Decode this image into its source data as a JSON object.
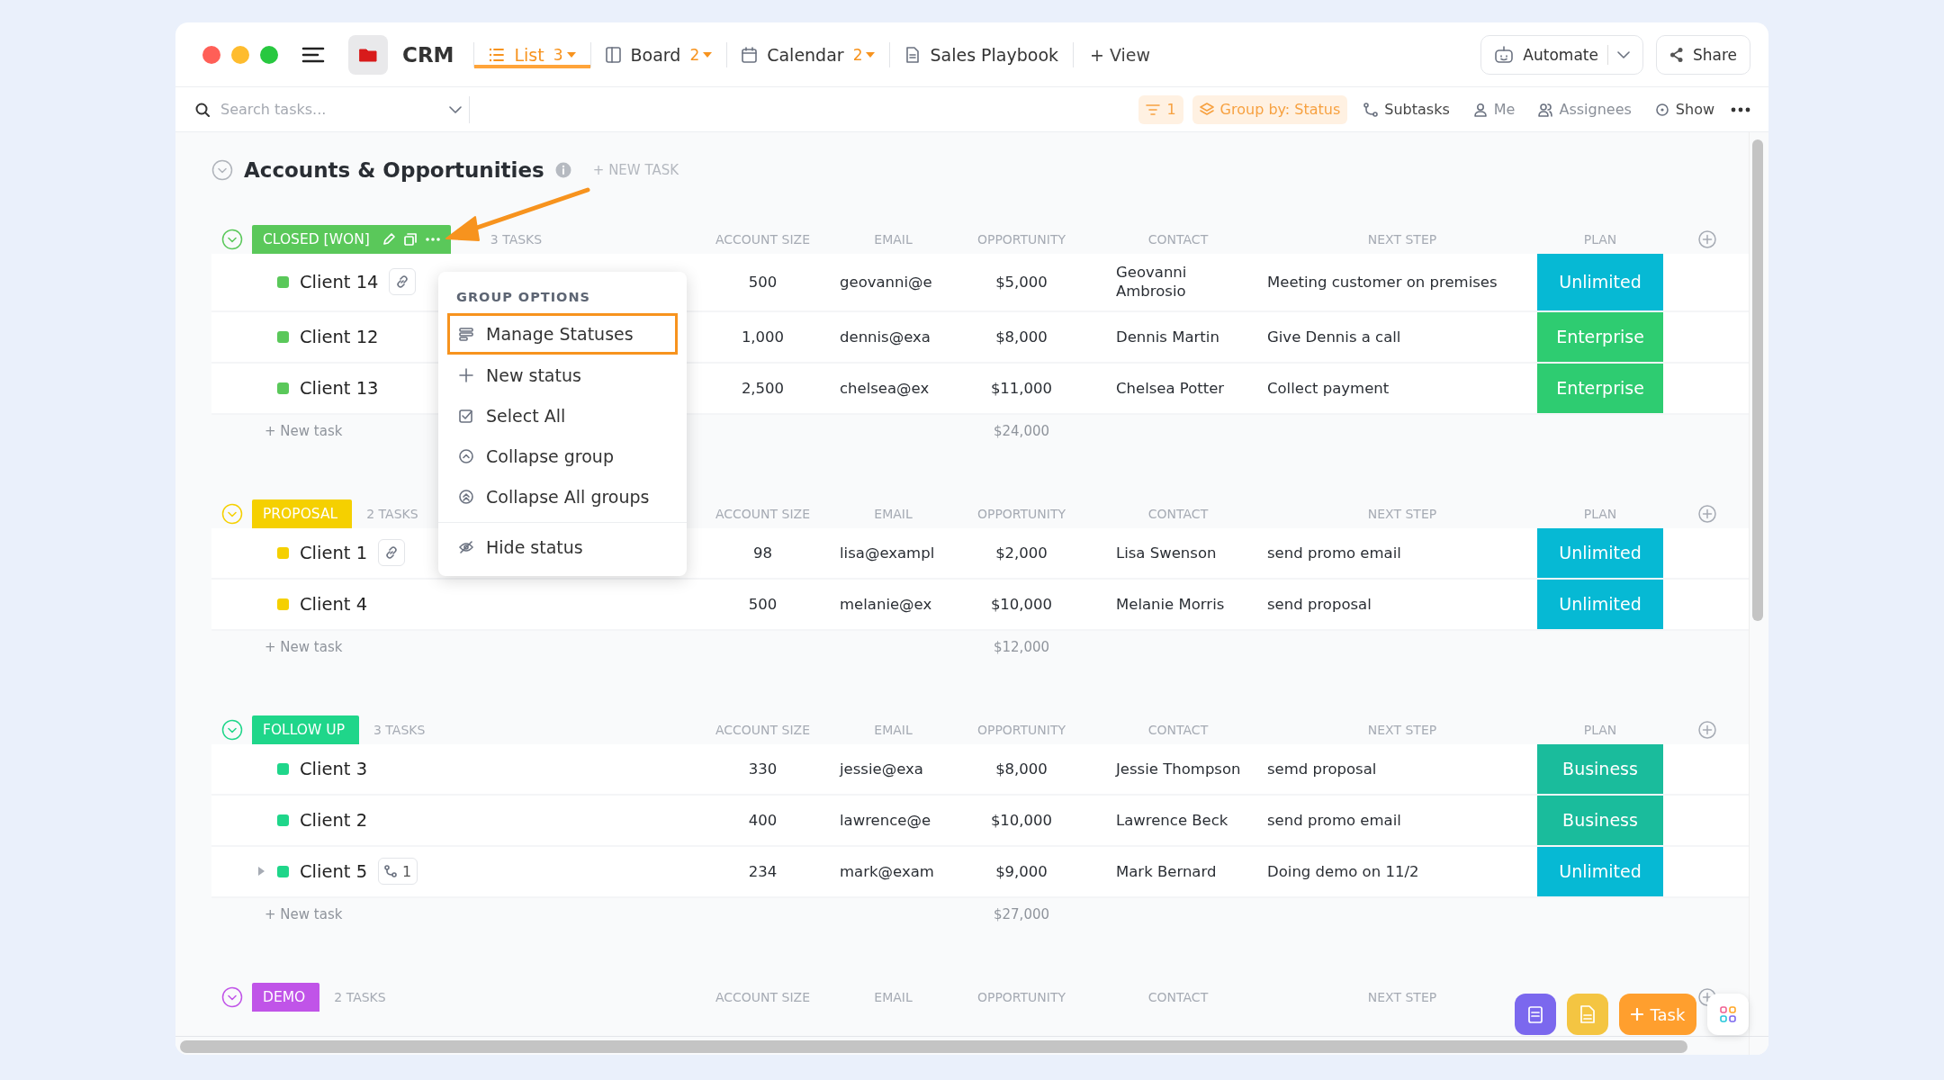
{
  "window": {
    "title": "CRM"
  },
  "tabs": [
    {
      "label": "List",
      "count": "3",
      "selected": true,
      "kind": "list"
    },
    {
      "label": "Board",
      "count": "2",
      "selected": false,
      "kind": "board"
    },
    {
      "label": "Calendar",
      "count": "2",
      "selected": false,
      "kind": "calendar"
    },
    {
      "label": "Sales Playbook",
      "selected": false,
      "kind": "doc"
    }
  ],
  "add_view": "+ View",
  "actions": {
    "automate": "Automate",
    "share": "Share"
  },
  "toolbar": {
    "search_placeholder": "Search tasks...",
    "filter_count": "1",
    "group_by": "Group by: Status",
    "subtasks": "Subtasks",
    "me": "Me",
    "assignees": "Assignees",
    "show": "Show"
  },
  "list": {
    "title": "Accounts & Opportunities",
    "new_task": "+ NEW TASK"
  },
  "groups": [
    {
      "name": "CLOSED [WON]",
      "color": "#5ac85a",
      "hovered": true,
      "task_count": "3 TASKS",
      "columns": [
        "ACCOUNT SIZE",
        "EMAIL",
        "OPPORTUNITY",
        "CONTACT",
        "NEXT STEP",
        "PLAN"
      ],
      "rows": [
        {
          "name": "Client 14",
          "badge": {
            "kind": "link"
          },
          "account_size": "500",
          "email": "geovanni@e",
          "opportunity": "$5,000",
          "contact": "Geovanni Ambrosio",
          "next_step": "Meeting customer on premises",
          "plan": {
            "label": "Unlimited",
            "color": "#06b9d4"
          }
        },
        {
          "name": "Client 12",
          "account_size": "1,000",
          "email": "dennis@exa",
          "opportunity": "$8,000",
          "contact": "Dennis Martin",
          "next_step": "Give Dennis a call",
          "plan": {
            "label": "Enterprise",
            "color": "#2ecc71"
          }
        },
        {
          "name": "Client 13",
          "account_size": "2,500",
          "email": "chelsea@ex",
          "opportunity": "$11,000",
          "contact": "Chelsea Potter",
          "next_step": "Collect payment",
          "plan": {
            "label": "Enterprise",
            "color": "#2ecc71"
          }
        }
      ],
      "new_task": "+ New task",
      "total": "$24,000"
    },
    {
      "name": "PROPOSAL",
      "color": "#f5d000",
      "hovered": false,
      "task_count": "2 TASKS",
      "columns": [
        "ACCOUNT SIZE",
        "EMAIL",
        "OPPORTUNITY",
        "CONTACT",
        "NEXT STEP",
        "PLAN"
      ],
      "rows": [
        {
          "name": "Client 1",
          "badge": {
            "kind": "link"
          },
          "account_size": "98",
          "email": "lisa@exampl",
          "opportunity": "$2,000",
          "contact": "Lisa Swenson",
          "next_step": "send promo email",
          "plan": {
            "label": "Unlimited",
            "color": "#06b9d4"
          }
        },
        {
          "name": "Client 4",
          "account_size": "500",
          "email": "melanie@ex",
          "opportunity": "$10,000",
          "contact": "Melanie Morris",
          "next_step": "send proposal",
          "plan": {
            "label": "Unlimited",
            "color": "#06b9d4"
          }
        }
      ],
      "new_task": "+ New task",
      "total": "$12,000"
    },
    {
      "name": "FOLLOW UP",
      "color": "#1fd68a",
      "hovered": false,
      "task_count": "3 TASKS",
      "columns": [
        "ACCOUNT SIZE",
        "EMAIL",
        "OPPORTUNITY",
        "CONTACT",
        "NEXT STEP",
        "PLAN"
      ],
      "rows": [
        {
          "name": "Client 3",
          "account_size": "330",
          "email": "jessie@exa",
          "opportunity": "$8,000",
          "contact": "Jessie Thompson",
          "next_step": "semd proposal",
          "plan": {
            "label": "Business",
            "color": "#1abc9c"
          }
        },
        {
          "name": "Client 2",
          "account_size": "400",
          "email": "lawrence@e",
          "opportunity": "$10,000",
          "contact": "Lawrence Beck",
          "next_step": "send promo email",
          "plan": {
            "label": "Business",
            "color": "#1abc9c"
          }
        },
        {
          "name": "Client 5",
          "badge": {
            "kind": "subtasks",
            "count": "1"
          },
          "account_size": "234",
          "email": "mark@exam",
          "opportunity": "$9,000",
          "contact": "Mark Bernard",
          "next_step": "Doing demo on 11/2",
          "plan": {
            "label": "Unlimited",
            "color": "#06b9d4"
          }
        }
      ],
      "new_task": "+ New task",
      "total": "$27,000"
    },
    {
      "name": "DEMO",
      "color": "#c054e8",
      "hovered": false,
      "task_count": "2 TASKS",
      "columns": [
        "ACCOUNT SIZE",
        "EMAIL",
        "OPPORTUNITY",
        "CONTACT",
        "NEXT STEP"
      ]
    }
  ],
  "menu": {
    "heading": "GROUP OPTIONS",
    "items": [
      {
        "label": "Manage Statuses",
        "selected": true,
        "divider_before": false
      },
      {
        "label": "New status",
        "selected": false,
        "divider_before": false
      },
      {
        "label": "Select All",
        "selected": false,
        "divider_before": false
      },
      {
        "label": "Collapse group",
        "selected": false,
        "divider_before": false
      },
      {
        "label": "Collapse All groups",
        "selected": false,
        "divider_before": false
      },
      {
        "label": "Hide status",
        "selected": false,
        "divider_before": true
      }
    ]
  },
  "fab": {
    "task": "Task"
  }
}
